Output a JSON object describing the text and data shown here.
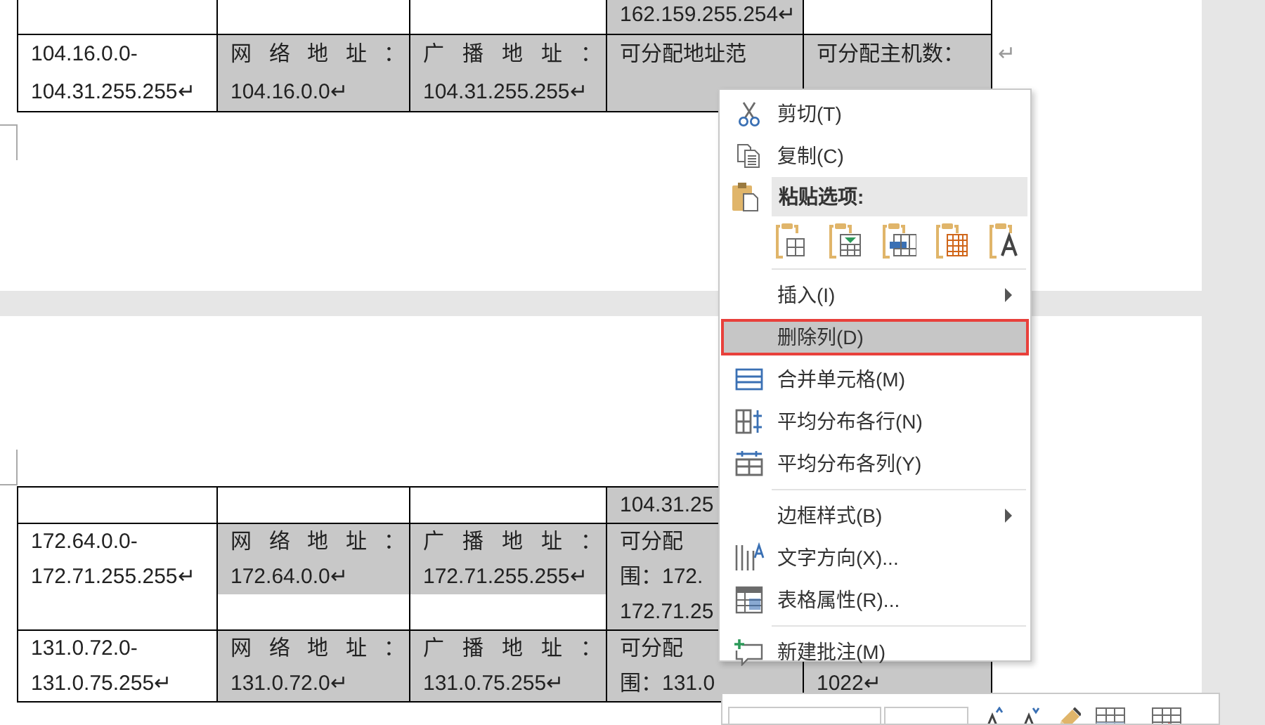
{
  "pages": [
    {
      "table": {
        "rows": [
          {
            "cells": [
              {
                "kind": "empty"
              },
              {
                "kind": "empty"
              },
              {
                "kind": "empty"
              },
              {
                "kind": "text",
                "text": "162.159.255.254↵",
                "shaded": true
              },
              {
                "kind": "empty"
              }
            ]
          },
          {
            "cells": [
              {
                "kind": "text",
                "text": "104.16.0.0-104.31.255.255↵",
                "shaded": false
              },
              {
                "kind": "text",
                "text": "网络地址：104.16.0.0↵",
                "shaded": true
              },
              {
                "kind": "text",
                "text": "广播地址：104.31.255.255↵",
                "shaded": true
              },
              {
                "kind": "partial",
                "lines": [
                  "可分配地址范"
                ],
                "shaded": true
              },
              {
                "kind": "partial",
                "lines": [
                  "可分配主机数："
                ],
                "shaded": true
              }
            ],
            "end_mark": "↵"
          }
        ]
      }
    },
    {
      "table": {
        "rows": [
          {
            "cells": [
              {
                "kind": "empty"
              },
              {
                "kind": "empty"
              },
              {
                "kind": "empty"
              },
              {
                "kind": "partial",
                "lines": [
                  "104.31.25"
                ],
                "shaded": true
              },
              {
                "kind": "empty"
              }
            ]
          },
          {
            "cells": [
              {
                "kind": "text",
                "text": "172.64.0.0-172.71.255.255↵",
                "shaded": false
              },
              {
                "kind": "text",
                "text": "网络地址：172.64.0.0↵",
                "shaded": true
              },
              {
                "kind": "text",
                "text": "广播地址：172.71.255.255↵",
                "shaded": true
              },
              {
                "kind": "partial",
                "lines": [
                  "可分配",
                  "围：172.",
                  "172.71.25"
                ],
                "shaded": true
              },
              {
                "kind": "empty"
              }
            ]
          },
          {
            "cells": [
              {
                "kind": "text",
                "text": "131.0.72.0-131.0.75.255↵",
                "shaded": false
              },
              {
                "kind": "text",
                "text": "网络地址：131.0.72.0↵",
                "shaded": true
              },
              {
                "kind": "text",
                "text": "广播地址：131.0.75.255↵",
                "shaded": true
              },
              {
                "kind": "partial",
                "lines": [
                  "可分配",
                  "围：131.0"
                ],
                "shaded": true
              },
              {
                "kind": "partial",
                "lines": [
                  "1022↵"
                ],
                "shaded": true,
                "first_line_covered": true
              }
            ]
          }
        ]
      }
    }
  ],
  "context_menu": {
    "items": [
      {
        "kind": "command",
        "label": "剪切(T)",
        "highlighted": false,
        "submenu": false
      },
      {
        "kind": "command",
        "label": "复制(C)",
        "highlighted": false,
        "submenu": false
      },
      {
        "kind": "header",
        "label": "粘贴选项:"
      },
      {
        "kind": "paste_options"
      },
      {
        "kind": "separator"
      },
      {
        "kind": "command",
        "label": "插入(I)",
        "highlighted": false,
        "submenu": true
      },
      {
        "kind": "command",
        "label": "删除列(D)",
        "highlighted": true,
        "submenu": false
      },
      {
        "kind": "command",
        "label": "合并单元格(M)",
        "highlighted": false,
        "submenu": false
      },
      {
        "kind": "command",
        "label": "平均分布各行(N)",
        "highlighted": false,
        "submenu": false
      },
      {
        "kind": "command",
        "label": "平均分布各列(Y)",
        "highlighted": false,
        "submenu": false
      },
      {
        "kind": "separator"
      },
      {
        "kind": "command",
        "label": "边框样式(B)",
        "highlighted": false,
        "submenu": true
      },
      {
        "kind": "command",
        "label": "文字方向(X)...",
        "highlighted": false,
        "submenu": false
      },
      {
        "kind": "command",
        "label": "表格属性(R)...",
        "highlighted": false,
        "submenu": false
      },
      {
        "kind": "separator"
      },
      {
        "kind": "command",
        "label": "新建批注(M)",
        "highlighted": false,
        "submenu": false
      }
    ]
  }
}
